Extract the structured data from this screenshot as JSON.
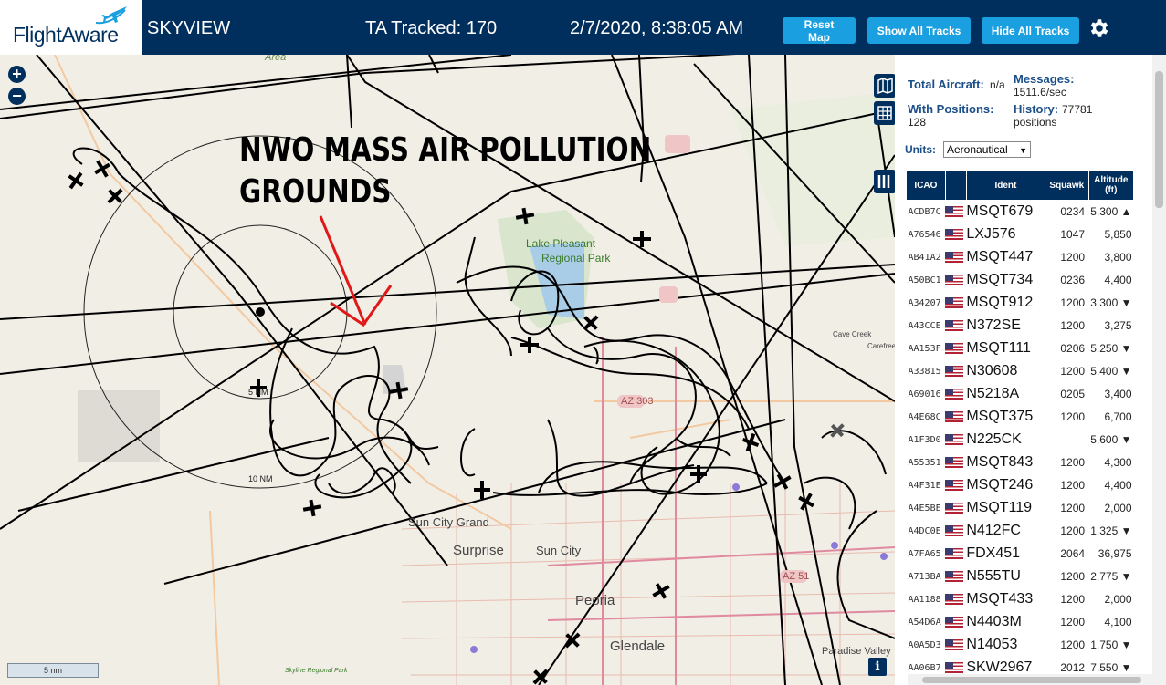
{
  "header": {
    "logo": "FlightAware",
    "app_name": "SKYVIEW",
    "tracked": "TA Tracked: 170",
    "datetime": "2/7/2020, 8:38:05 AM",
    "buttons": {
      "reset": "Reset Map",
      "show": "Show All Tracks",
      "hide": "Hide All Tracks"
    },
    "settings_icon": "gear-icon"
  },
  "map": {
    "zoom_in": "+",
    "zoom_out": "−",
    "overlay_text_line1": "NWO MASS AIR POLLUTION",
    "overlay_text_line2": "GROUNDS",
    "labels": {
      "area": "Area",
      "lake": "Lake Pleasant",
      "park": "Regional Park",
      "sun_city_grand": "Sun City Grand",
      "surprise": "Surprise",
      "sun_city": "Sun City",
      "peoria": "Peoria",
      "glendale": "Glendale",
      "paradise_valley": "Paradise Valley",
      "cave_creek": "Cave Creek",
      "carefree": "Carefree",
      "az303": "AZ 303",
      "az51": "AZ 51",
      "ring_5nm": "5 NM",
      "ring_10nm": "10 NM",
      "skyline": "Skyline Regional Park"
    },
    "scale": "5 nm",
    "info": "i",
    "layer_icons": [
      "map-icon",
      "grid-icon",
      "columns-icon"
    ]
  },
  "panel": {
    "total_aircraft_label": "Total Aircraft:",
    "total_aircraft_value": "n/a",
    "with_positions_label": "With Positions:",
    "with_positions_value": "128",
    "messages_label": "Messages:",
    "messages_value": "1511.6/sec",
    "history_label": "History:",
    "history_value": "77781",
    "history_unit": "positions",
    "units_label": "Units:",
    "units_value": "Aeronautical",
    "columns": [
      "ICAO",
      "",
      "Ident",
      "Squawk",
      "Altitude (ft)"
    ],
    "rows": [
      {
        "icao": "ACDB7C",
        "ident": "MSQT679",
        "squawk": "0234",
        "alt": "5,300 ▲"
      },
      {
        "icao": "A76546",
        "ident": "LXJ576",
        "squawk": "1047",
        "alt": "5,850"
      },
      {
        "icao": "AB41A2",
        "ident": "MSQT447",
        "squawk": "1200",
        "alt": "3,800"
      },
      {
        "icao": "A50BC1",
        "ident": "MSQT734",
        "squawk": "0236",
        "alt": "4,400"
      },
      {
        "icao": "A34207",
        "ident": "MSQT912",
        "squawk": "1200",
        "alt": "3,300 ▼"
      },
      {
        "icao": "A43CCE",
        "ident": "N372SE",
        "squawk": "1200",
        "alt": "3,275"
      },
      {
        "icao": "AA153F",
        "ident": "MSQT111",
        "squawk": "0206",
        "alt": "5,250 ▼"
      },
      {
        "icao": "A33815",
        "ident": "N30608",
        "squawk": "1200",
        "alt": "5,400 ▼"
      },
      {
        "icao": "A69016",
        "ident": "N5218A",
        "squawk": "0205",
        "alt": "3,400"
      },
      {
        "icao": "A4E68C",
        "ident": "MSQT375",
        "squawk": "1200",
        "alt": "6,700"
      },
      {
        "icao": "A1F3D0",
        "ident": "N225CK",
        "squawk": "",
        "alt": "5,600 ▼"
      },
      {
        "icao": "A55351",
        "ident": "MSQT843",
        "squawk": "1200",
        "alt": "4,300"
      },
      {
        "icao": "A4F31E",
        "ident": "MSQT246",
        "squawk": "1200",
        "alt": "4,400"
      },
      {
        "icao": "A4E5BE",
        "ident": "MSQT119",
        "squawk": "1200",
        "alt": "2,000"
      },
      {
        "icao": "A4DC0E",
        "ident": "N412FC",
        "squawk": "1200",
        "alt": "1,325 ▼"
      },
      {
        "icao": "A7FA65",
        "ident": "FDX451",
        "squawk": "2064",
        "alt": "36,975"
      },
      {
        "icao": "A713BA",
        "ident": "N555TU",
        "squawk": "1200",
        "alt": "2,775 ▼"
      },
      {
        "icao": "AA1188",
        "ident": "MSQT433",
        "squawk": "1200",
        "alt": "2,000"
      },
      {
        "icao": "A54D6A",
        "ident": "N4403M",
        "squawk": "1200",
        "alt": "4,100"
      },
      {
        "icao": "A0A5D3",
        "ident": "N14053",
        "squawk": "1200",
        "alt": "1,750 ▼"
      },
      {
        "icao": "AA06B7",
        "ident": "SKW2967",
        "squawk": "2012",
        "alt": "7,550 ▼"
      }
    ]
  },
  "colors": {
    "header_bg": "#002f5d",
    "button_bg": "#1a9fe0",
    "label_blue": "#1b4f8a"
  }
}
